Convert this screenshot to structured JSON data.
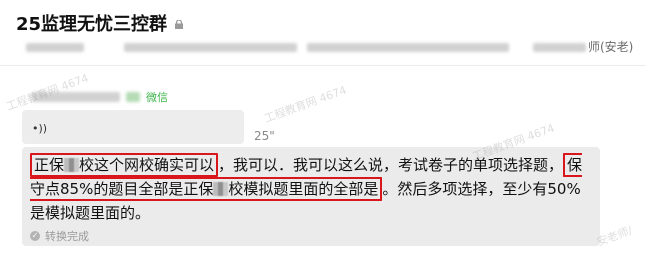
{
  "header": {
    "title": "25监理无忧三控群",
    "subtitle_tail": "师(安老)"
  },
  "message": {
    "sender_tag": "微信",
    "voice_icon": "•))",
    "duration": "25\"",
    "transcript": {
      "line1_box": "正保",
      "line1_box_b": "校这个网校确实可以",
      "line1_rest": "，我可以．我可以这么说，考试卷子的单项选择题，",
      "line2_box": "保守点85%的题目全部是正保",
      "line2_box_b": "校模拟题里面的全部是",
      "line2_rest": "。然后多项选择，至少有50%是模拟题里面的。"
    },
    "status": "转换完成"
  },
  "watermarks": [
    "工程教育网 4674",
    "工程教育网 4674",
    "工程教育网 4674",
    "安老师/"
  ],
  "colors": {
    "highlight": "#d8161b",
    "wechat_green": "#3bb34a"
  },
  "icons": {
    "lock": "lock-icon",
    "voice": "voice-wave-icon",
    "status": "check-circle-icon"
  }
}
